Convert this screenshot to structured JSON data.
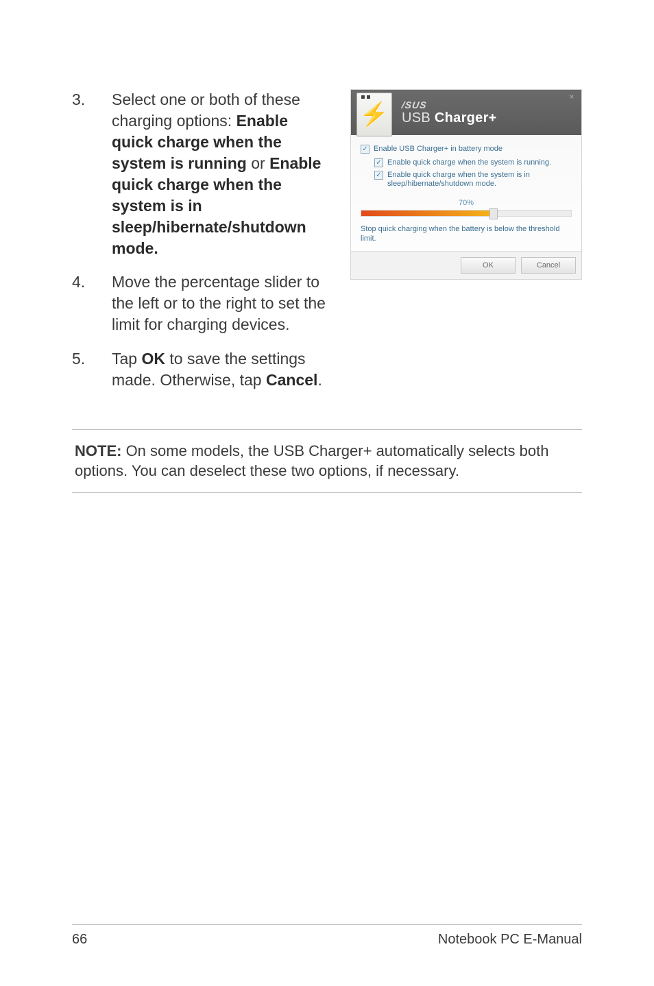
{
  "steps": [
    {
      "num": "3.",
      "pre": "Select one or both of these charging options: ",
      "bold1": "Enable quick charge when the system is running",
      "mid": " or ",
      "bold2": "Enable quick charge when the system is in sleep/hibernate/shutdown mode."
    },
    {
      "num": "4.",
      "text": "Move the percentage slider to the left or to the right to set the limit for charging devices."
    },
    {
      "num": "5.",
      "pre": "Tap ",
      "bold1": "OK",
      "mid": " to save the settings made. Otherwise, tap ",
      "bold2": "Cancel",
      "post": "."
    }
  ],
  "dialog": {
    "brand": "/SUS",
    "title_thin": "USB ",
    "title_bold": "Charger+",
    "close": "×",
    "checkbox_main": "Enable USB Charger+ in battery mode",
    "checkbox_sub1": "Enable quick charge when the system is running.",
    "checkbox_sub2": "Enable quick charge when the system is in sleep/hibernate/shutdown mode.",
    "slider_pct": "70%",
    "slider_note": "Stop quick charging when the battery is below the threshold limit.",
    "ok": "OK",
    "cancel": "Cancel"
  },
  "note": {
    "label": "NOTE:",
    "text": " On some models, the USB Charger+ automatically selects both options. You can deselect these two options, if necessary."
  },
  "footer": {
    "page": "66",
    "doc": "Notebook PC E-Manual"
  }
}
